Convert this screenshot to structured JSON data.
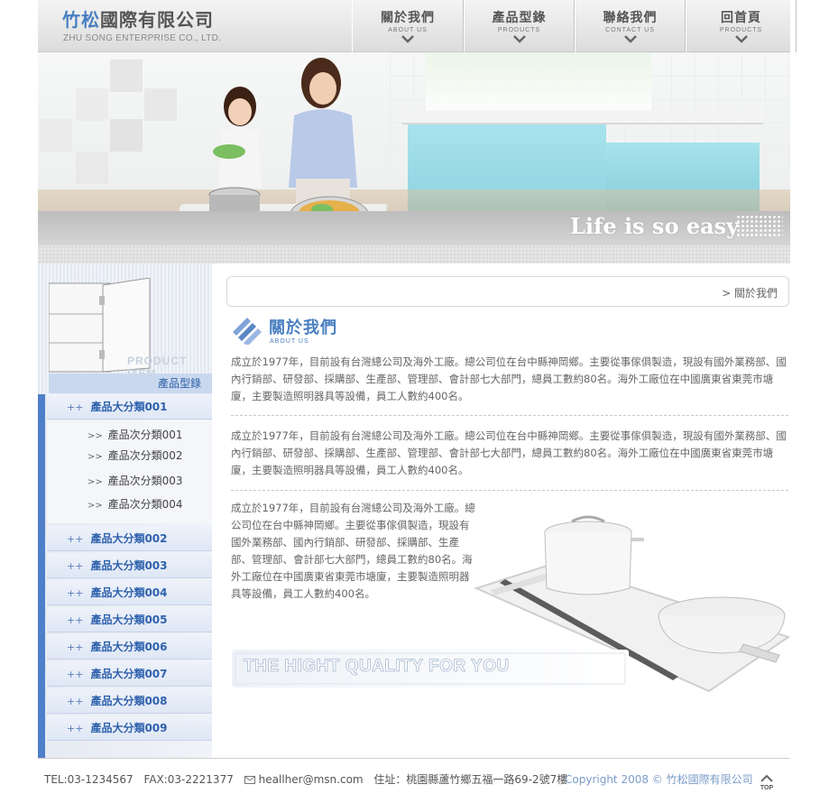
{
  "header": {
    "logo_accent": "竹松",
    "logo_rest": "國際有限公司",
    "logo_en": "ZHU SONG ENTERPRISE CO., LTD.",
    "nav": [
      {
        "cn": "關於我們",
        "en": "ABOUT US"
      },
      {
        "cn": "產品型錄",
        "en": "PRODUCTS"
      },
      {
        "cn": "聯絡我們",
        "en": "CONTACT US"
      },
      {
        "cn": "回首頁",
        "en": "PRODUCTS"
      }
    ]
  },
  "banner": {
    "slogan": "Life is so easy"
  },
  "sidebar": {
    "header_en": "PRODUCT ITEM",
    "header_cn": "產品型錄",
    "categories": [
      {
        "label": "產品大分類001"
      },
      {
        "label": "產品大分類002"
      },
      {
        "label": "產品大分類003"
      },
      {
        "label": "產品大分類004"
      },
      {
        "label": "產品大分類005"
      },
      {
        "label": "產品大分類006"
      },
      {
        "label": "產品大分類007"
      },
      {
        "label": "產品大分類008"
      },
      {
        "label": "產品大分類009"
      }
    ],
    "bullet": "++",
    "sub_arrow": ">>",
    "subcategories": [
      {
        "label": "產品次分類001"
      },
      {
        "label": "產品次分類002"
      },
      {
        "label": "產品次分類003"
      },
      {
        "label": "產品次分類004"
      }
    ]
  },
  "main": {
    "breadcrumb": "> 關於我們",
    "section_title_cn": "關於我們",
    "section_title_en": "ABOUT US",
    "paragraph1": "成立於1977年，目前設有台灣總公司及海外工廠。總公司位在台中縣神岡鄉。主要從事傢俱製造，現設有國外業務部、國內行銷部、研發部、採購部、生產部、管理部、會計部七大部門，總員工數約80名。海外工廠位在中國廣東省東莞市塘廈，主要製造照明器具等設備，員工人數約400名。",
    "paragraph2": "成立於1977年，目前設有台灣總公司及海外工廠。總公司位在台中縣神岡鄉。主要從事傢俱製造，現設有國外業務部、國內行銷部、研發部、採購部、生產部、管理部、會計部七大部門，總員工數約80名。海外工廠位在中國廣東省東莞市塘廈，主要製造照明器具等設備，員工人數約400名。",
    "paragraph3": "成立於1977年，目前設有台灣總公司及海外工廠。總公司位在台中縣神岡鄉。主要從事傢俱製造，現設有國外業務部、國內行銷部、研發部、採購部、生產部、管理部、會計部七大部門，總員工數約80名。海外工廠位在中國廣東省東莞市塘廈，主要製造照明器具等設備，員工人數約400名。",
    "quality_text": "THE HIGHT QUALITY FOR YOU"
  },
  "footer": {
    "tel": "TEL:03-1234567",
    "fax": "FAX:03-2221377",
    "email": "heallher@msn.com",
    "address": "住址：桃園縣蘆竹鄉五福一路69-2號7樓",
    "copyright": "Copyright  2008  © 竹松國際有限公司",
    "top_label": "TOP"
  },
  "colors": {
    "accent": "#4a7fc1",
    "sidebar_rail": "#4f7fc9",
    "category_text": "#2f62ad"
  }
}
